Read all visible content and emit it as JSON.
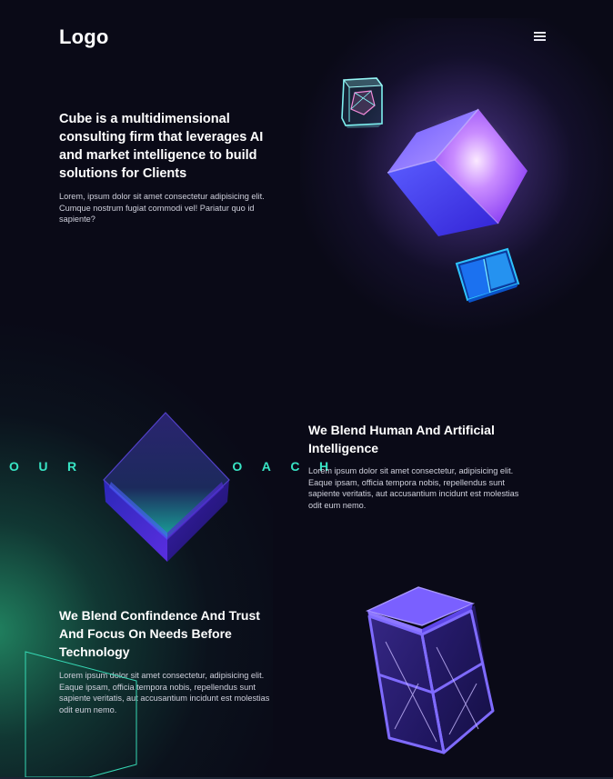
{
  "header": {
    "logo": "Logo",
    "menu_icon": "hamburger-menu-icon"
  },
  "hero": {
    "title": "Cube is a multidimensional consulting firm that leverages AI and market intelligence to build solutions for Clients",
    "text": "Lorem, ipsum dolor sit amet consectetur adipisicing elit. Cumque nostrum fugiat commodi vel! Pariatur quo id sapiente?"
  },
  "approach": {
    "label": "OUR APPROACH"
  },
  "section_human_ai": {
    "title": "We Blend Human And Artificial Intelligence",
    "text": "Lorem ipsum dolor sit amet consectetur, adipisicing elit. Eaque ipsam, officia tempora nobis, repellendus sunt sapiente veritatis, aut accusantium incidunt est molestias odit eum nemo."
  },
  "section_trust": {
    "title": "We Blend Confindence And Trust And Focus On Needs Before Technology",
    "text": "Lorem ipsum dolor sit amet consectetur, adipisicing elit. Eaque ipsam, officia tempora nobis, repellendus sunt sapiente veritatis, aut accusantium incidunt est molestias odit eum nemo."
  },
  "colors": {
    "background": "#0a0a17",
    "accent_teal": "#38e4c4",
    "accent_purple": "#7b4dff",
    "accent_blue": "#1ea8ff"
  }
}
